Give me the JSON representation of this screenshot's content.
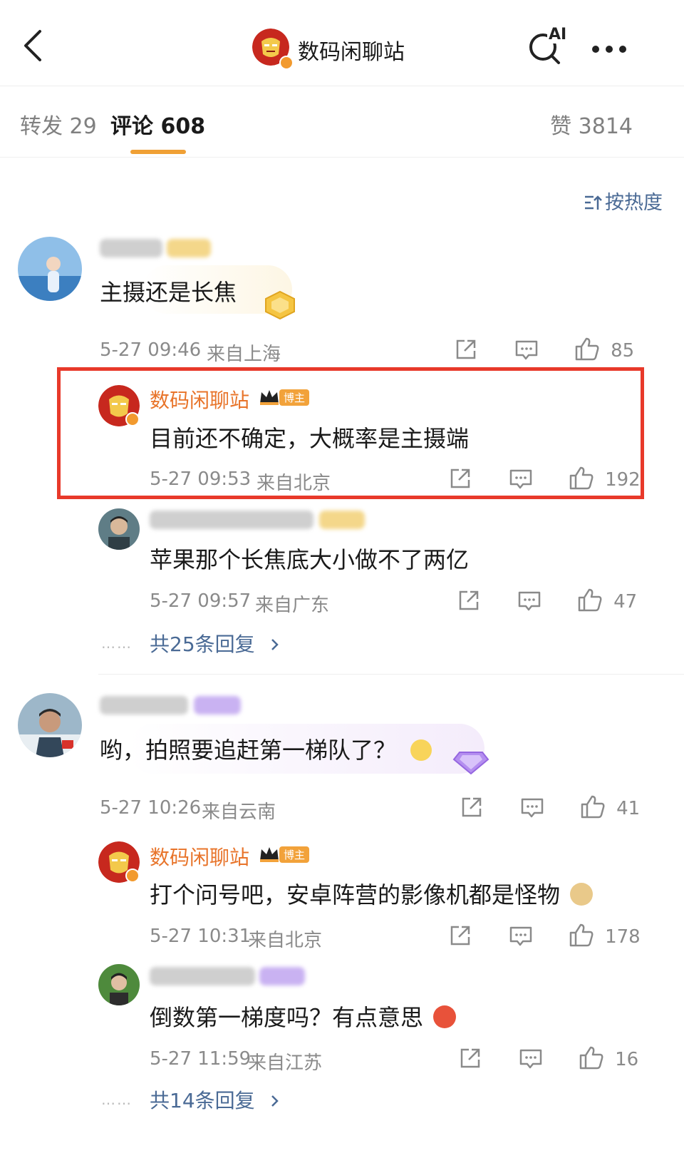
{
  "header": {
    "title": "数码闲聊站",
    "ai_label": "AI"
  },
  "tabs": [
    {
      "label": "转发 29"
    },
    {
      "label": "评论 608"
    }
  ],
  "likes_total": "赞 3814",
  "sort_label": "按热度",
  "threads": [
    {
      "comment": {
        "text": "主摄还是长焦",
        "time": "5-27 09:46",
        "location": "来自上海",
        "likes": "85"
      },
      "replies": [
        {
          "name": "数码闲聊站",
          "badge": "博主",
          "text": "目前还不确定，大概率是主摄端",
          "time": "5-27 09:53",
          "location": "来自北京",
          "likes": "192"
        },
        {
          "text": "苹果那个长焦底大小做不了两亿",
          "time": "5-27 09:57",
          "location": "来自广东",
          "likes": "47"
        }
      ],
      "more": "共25条回复"
    },
    {
      "comment": {
        "text": "哟，拍照要追赶第一梯队了？",
        "time": "5-27 10:26",
        "location": "来自云南",
        "likes": "41"
      },
      "replies": [
        {
          "name": "数码闲聊站",
          "badge": "博主",
          "text": "打个问号吧，安卓阵营的影像机都是怪物",
          "time": "5-27 10:31",
          "location": "来自北京",
          "likes": "178"
        },
        {
          "text": "倒数第一梯度吗？有点意思",
          "time": "5-27 11:59",
          "location": "来自江苏",
          "likes": "16"
        }
      ],
      "more": "共14条回复"
    }
  ],
  "colors": {
    "accent": "#f0a035",
    "link": "#4a6a95",
    "highlight_box": "#e8392a",
    "blogger_name": "#e8742a"
  },
  "icons": [
    "back-icon",
    "ai-search-icon",
    "more-icon",
    "sort-icon",
    "share-icon",
    "comment-icon",
    "like-icon",
    "chevron-right-icon"
  ]
}
